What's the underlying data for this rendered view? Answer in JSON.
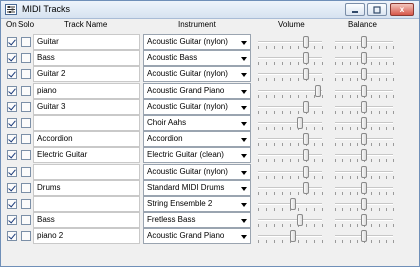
{
  "window": {
    "title": "MIDI Tracks",
    "icon": "sliders-icon",
    "buttons": [
      "minimize",
      "maximize",
      "close"
    ],
    "close_label": "x"
  },
  "columns": {
    "on": "On",
    "solo": "Solo",
    "track_name": "Track Name",
    "instrument": "Instrument",
    "volume": "Volume",
    "balance": "Balance"
  },
  "tracks": [
    {
      "on": true,
      "solo": false,
      "name": "Guitar",
      "instrument": "Acoustic Guitar (nylon)",
      "volume": 0.75,
      "balance": 0.5
    },
    {
      "on": true,
      "solo": false,
      "name": "Bass",
      "instrument": "Acoustic Bass",
      "volume": 0.75,
      "balance": 0.5
    },
    {
      "on": true,
      "solo": false,
      "name": "Guitar 2",
      "instrument": "Acoustic Guitar (nylon)",
      "volume": 0.75,
      "balance": 0.5
    },
    {
      "on": true,
      "solo": false,
      "name": "piano",
      "instrument": "Acoustic Grand Piano",
      "volume": 0.93,
      "balance": 0.5
    },
    {
      "on": true,
      "solo": false,
      "name": "Guitar 3",
      "instrument": "Acoustic Guitar (nylon)",
      "volume": 0.75,
      "balance": 0.5
    },
    {
      "on": true,
      "solo": false,
      "name": "",
      "instrument": "Choir Aahs",
      "volume": 0.65,
      "balance": 0.5
    },
    {
      "on": true,
      "solo": false,
      "name": "Accordion",
      "instrument": "Accordion",
      "volume": 0.75,
      "balance": 0.5
    },
    {
      "on": true,
      "solo": false,
      "name": "Electric Guitar",
      "instrument": "Electric Guitar (clean)",
      "volume": 0.75,
      "balance": 0.5
    },
    {
      "on": true,
      "solo": false,
      "name": "",
      "instrument": "Acoustic Guitar (nylon)",
      "volume": 0.75,
      "balance": 0.5
    },
    {
      "on": true,
      "solo": false,
      "name": "Drums",
      "instrument": "Standard MIDI Drums",
      "volume": 0.75,
      "balance": 0.5
    },
    {
      "on": true,
      "solo": false,
      "name": "",
      "instrument": "String Ensemble 2",
      "volume": 0.55,
      "balance": 0.5
    },
    {
      "on": true,
      "solo": false,
      "name": "Bass",
      "instrument": "Fretless Bass",
      "volume": 0.65,
      "balance": 0.5
    },
    {
      "on": true,
      "solo": false,
      "name": "piano 2",
      "instrument": "Acoustic Grand Piano",
      "volume": 0.55,
      "balance": 0.5
    }
  ]
}
